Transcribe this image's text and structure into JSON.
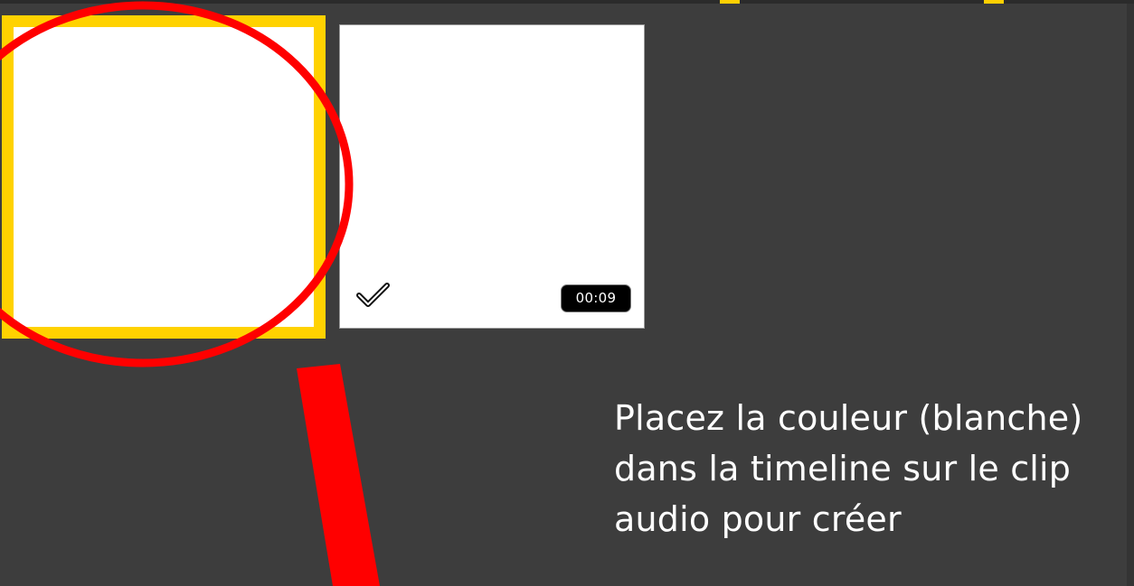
{
  "media_bin": {
    "items": [
      {
        "kind": "color",
        "color": "#ffffff",
        "selected": true,
        "selection_color": "#ffd200"
      },
      {
        "kind": "color",
        "color": "#ffffff",
        "selected": false,
        "used_icon": "checkmark-icon",
        "duration": "00:09"
      }
    ]
  },
  "annotation": {
    "highlight_color": "#ff0000",
    "instruction_text": "Placez la couleur (blanche) dans la timeline sur le clip audio pour créer"
  },
  "theme": {
    "background": "#3d3d3d",
    "accent": "#ffd000"
  }
}
